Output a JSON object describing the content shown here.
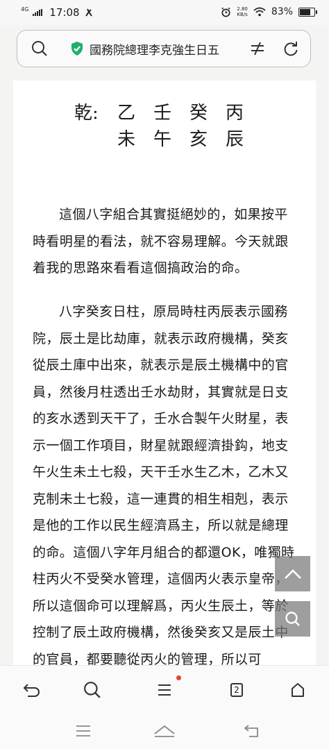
{
  "status_bar": {
    "network": "4G",
    "time": "17:08",
    "speed_value": "2.80",
    "speed_unit": "KB/s",
    "battery_text": "83%",
    "battery_level": 0.83
  },
  "address_bar": {
    "page_title": "國務院總理李克強生日五"
  },
  "article": {
    "bazi_label": "乾:",
    "stems": [
      "乙",
      "壬",
      "癸",
      "丙"
    ],
    "branches": [
      "未",
      "午",
      "亥",
      "辰"
    ],
    "paragraphs": [
      "這個八字組合其實挺絕妙的，如果按平時看明星的看法，就不容易理解。今天就跟着我的思路來看看這個搞政治的命。",
      "八字癸亥日柱，原局時柱丙辰表示國務院，辰土是比劫庫，就表示政府機構，癸亥從辰土庫中出來，就表示是辰土機構中的官員，然後月柱透出壬水劫財，其實就是日支的亥水透到天干了，壬水合製午火財星，表示一個工作項目，財星就跟經濟掛鈎，地支午火生未土七殺，天干壬水生乙木，乙木又克制未土七殺，這一連貫的相生相剋，表示是他的工作以民生經濟爲主，所以就是總理的命。這個八字年月組合的都還OK，唯獨時柱丙火不受癸水管理，這個丙火表示皇帝，所以這個命可以理解爲，丙火生辰土，等於控制了辰土政府機構，然後癸亥又是辰土中的官員，都要聽從丙火的管理，所以可"
    ]
  },
  "floating": {
    "scroll_top_icon": "chevron-up-icon",
    "search_icon": "search-icon"
  },
  "toolbar": {
    "tab_count": "2"
  }
}
